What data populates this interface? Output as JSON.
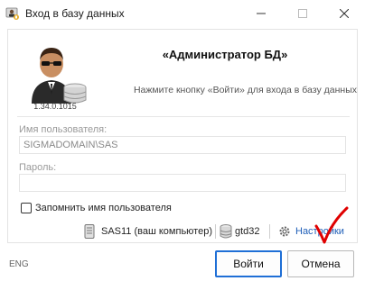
{
  "window": {
    "title": "Вход в базу данных"
  },
  "header": {
    "title": "«Администратор БД»",
    "hint": "Нажмите кнопку «Войти» для входа в базу данных",
    "version": "1.34.0.1015"
  },
  "form": {
    "username_label": "Имя пользователя:",
    "username_value": "SIGMADOMAIN\\SAS",
    "password_label": "Пароль:",
    "password_value": "",
    "remember_label": "Запомнить имя пользователя",
    "remember_checked": false
  },
  "status": {
    "server": "SAS11 (ваш компьютер)",
    "database": "gtd32",
    "settings_label": "Настройки"
  },
  "footer": {
    "language": "ENG",
    "ok_label": "Войти",
    "cancel_label": "Отмена"
  },
  "colors": {
    "accent": "#1f6fd6",
    "link": "#1f5fb8",
    "annotation": "#e00000"
  },
  "icons": {
    "app": "login-app-icon",
    "avatar": "admin-avatar-icon",
    "server": "server-icon",
    "database": "database-icon",
    "settings": "gear-icon",
    "annotation": "red-checkmark-icon"
  }
}
